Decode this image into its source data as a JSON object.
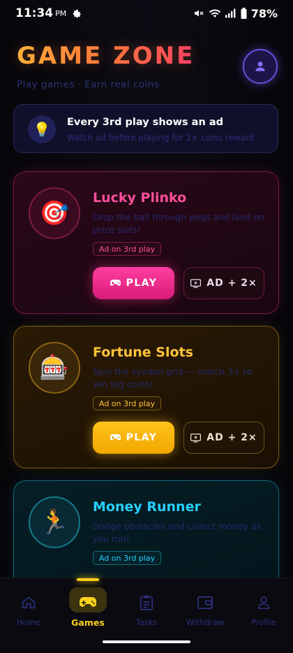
{
  "status_bar": {
    "time": "11:34",
    "ampm": "PM",
    "battery": "78%"
  },
  "header": {
    "title": "GAME ZONE",
    "subtitle": "Play games · Earn real coins"
  },
  "banner": {
    "title": "Every 3rd play shows an ad",
    "subtitle": "Watch ad before playing for 2× coins reward"
  },
  "games": [
    {
      "name": "Lucky Plinko",
      "description": "Drop the ball through pegs and land on prize slots!",
      "badge": "Ad on 3rd play",
      "play_label": "PLAY",
      "ad_label": "AD + 2×",
      "icon": "🎯"
    },
    {
      "name": "Fortune Slots",
      "description": "Spin the symbol grid — match 3+ to win big coins!",
      "badge": "Ad on 3rd play",
      "play_label": "PLAY",
      "ad_label": "AD + 2×",
      "icon": "🎰"
    },
    {
      "name": "Money Runner",
      "description": "Dodge obstacles and collect money as you run!",
      "badge": "Ad on 3rd play",
      "icon": "🏃"
    }
  ],
  "nav": [
    {
      "label": "Home",
      "icon": "home-icon"
    },
    {
      "label": "Games",
      "icon": "gamepad-icon",
      "active": true
    },
    {
      "label": "Tasks",
      "icon": "clipboard-icon"
    },
    {
      "label": "Withdraw",
      "icon": "wallet-icon"
    },
    {
      "label": "Profile",
      "icon": "person-icon"
    }
  ],
  "colors": {
    "pink": "#ff4f9c",
    "gold": "#ffc23a",
    "cyan": "#27d0ff",
    "nav_active": "#ffd21c"
  }
}
